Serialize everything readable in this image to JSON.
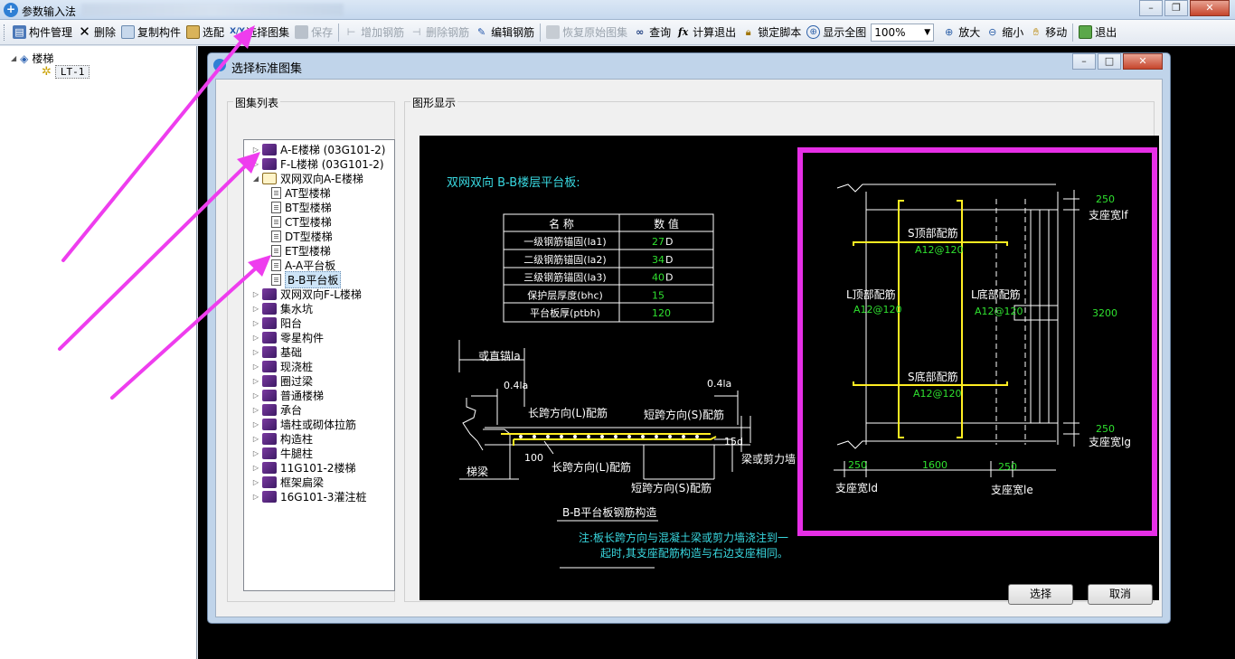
{
  "app": {
    "title": "参数输入法"
  },
  "toolbar": {
    "items": [
      {
        "label": "构件管理",
        "disabled": false
      },
      {
        "label": "删除",
        "disabled": false
      },
      {
        "label": "复制构件",
        "disabled": false
      },
      {
        "label": "选配",
        "disabled": false
      },
      {
        "label": "选择图集",
        "disabled": false
      },
      {
        "label": "保存",
        "disabled": true
      },
      {
        "label": "增加钢筋",
        "disabled": true
      },
      {
        "label": "删除钢筋",
        "disabled": true
      },
      {
        "label": "编辑钢筋",
        "disabled": false
      },
      {
        "label": "恢复原始图集",
        "disabled": true
      },
      {
        "label": "查询",
        "disabled": false
      },
      {
        "label": "计算退出",
        "disabled": false
      },
      {
        "label": "锁定脚本",
        "disabled": false
      },
      {
        "label": "显示全图",
        "disabled": false
      },
      {
        "label": "放大",
        "disabled": false
      },
      {
        "label": "缩小",
        "disabled": false
      },
      {
        "label": "移动",
        "disabled": false
      },
      {
        "label": "退出",
        "disabled": false
      }
    ],
    "zoom": "100%"
  },
  "tree": {
    "root": "楼梯",
    "child": "LT-1"
  },
  "dialog": {
    "title": "选择标准图集",
    "list_group_label": "图集列表",
    "display_group_label": "图形显示",
    "items": [
      {
        "label": "A-E楼梯 (03G101-2)",
        "level": 0,
        "icon": "book",
        "toggle": "▷"
      },
      {
        "label": "F-L楼梯 (03G101-2)",
        "level": 0,
        "icon": "book",
        "toggle": "▷"
      },
      {
        "label": "双网双向A-E楼梯",
        "level": 0,
        "icon": "book-open",
        "toggle": "◢"
      },
      {
        "label": "AT型楼梯",
        "level": 1,
        "icon": "doc",
        "toggle": ""
      },
      {
        "label": "BT型楼梯",
        "level": 1,
        "icon": "doc",
        "toggle": ""
      },
      {
        "label": "CT型楼梯",
        "level": 1,
        "icon": "doc",
        "toggle": ""
      },
      {
        "label": "DT型楼梯",
        "level": 1,
        "icon": "doc",
        "toggle": ""
      },
      {
        "label": "ET型楼梯",
        "level": 1,
        "icon": "doc",
        "toggle": ""
      },
      {
        "label": "A-A平台板",
        "level": 1,
        "icon": "doc",
        "toggle": ""
      },
      {
        "label": "B-B平台板",
        "level": 1,
        "icon": "doc",
        "toggle": "",
        "selected": true
      },
      {
        "label": "双网双向F-L楼梯",
        "level": 0,
        "icon": "book",
        "toggle": "▷"
      },
      {
        "label": "集水坑",
        "level": 0,
        "icon": "book",
        "toggle": "▷"
      },
      {
        "label": "阳台",
        "level": 0,
        "icon": "book",
        "toggle": "▷"
      },
      {
        "label": "零星构件",
        "level": 0,
        "icon": "book",
        "toggle": "▷"
      },
      {
        "label": "基础",
        "level": 0,
        "icon": "book",
        "toggle": "▷"
      },
      {
        "label": "现浇桩",
        "level": 0,
        "icon": "book",
        "toggle": "▷"
      },
      {
        "label": "圈过梁",
        "level": 0,
        "icon": "book",
        "toggle": "▷"
      },
      {
        "label": "普通楼梯",
        "level": 0,
        "icon": "book",
        "toggle": "▷"
      },
      {
        "label": "承台",
        "level": 0,
        "icon": "book",
        "toggle": "▷"
      },
      {
        "label": "墙柱或砌体拉筋",
        "level": 0,
        "icon": "book",
        "toggle": "▷"
      },
      {
        "label": "构造柱",
        "level": 0,
        "icon": "book",
        "toggle": "▷"
      },
      {
        "label": "牛腿柱",
        "level": 0,
        "icon": "book",
        "toggle": "▷"
      },
      {
        "label": "11G101-2楼梯",
        "level": 0,
        "icon": "book",
        "toggle": "▷"
      },
      {
        "label": "框架扁梁",
        "level": 0,
        "icon": "book",
        "toggle": "▷"
      },
      {
        "label": "16G101-3灌注桩",
        "level": 0,
        "icon": "book",
        "toggle": "▷"
      }
    ],
    "select_label": "选择",
    "cancel_label": "取消"
  },
  "drawing": {
    "heading": "双网双向 B-B楼层平台板:",
    "table_headers": [
      "名 称",
      "数 值"
    ],
    "table_rows": [
      {
        "name": "一级钢筋锚固(la1)",
        "value": "27",
        "unit": "D"
      },
      {
        "name": "二级钢筋锚固(la2)",
        "value": "34",
        "unit": "D"
      },
      {
        "name": "三级钢筋锚固(la3)",
        "value": "40",
        "unit": "D"
      },
      {
        "name": "保护层厚度(bhc)",
        "value": "15",
        "unit": ""
      },
      {
        "name": "平台板厚(ptbh)",
        "value": "120",
        "unit": ""
      }
    ],
    "section": {
      "straight_anchor": "或直锚la",
      "left_04la": "0.4la",
      "right_04la": "0.4la",
      "long_top": "长跨方向(L)配筋",
      "short_top": "短跨方向(S)配筋",
      "long_bottom": "长跨方向(L)配筋",
      "short_bottom": "短跨方向(S)配筋",
      "dim_100": "100",
      "dim_15d": "15d",
      "stair_beam": "梯梁",
      "beam_or_wall": "梁或剪力墙",
      "caption": "B-B平台板钢筋构造",
      "note_line1": "注:板长跨方向与混凝土梁或剪力墙浇注到一",
      "note_line2": "起时,其支座配筋构造与右边支座相同。"
    },
    "plan": {
      "s_top": "S顶部配筋",
      "s_top_val": "A12@120",
      "l_top": "L顶部配筋",
      "l_top_val": "A12@120",
      "l_bottom": "L底部配筋",
      "l_bottom_val": "A12@120",
      "s_bottom": "S底部配筋",
      "s_bottom_val": "A12@120",
      "dim_top": "250",
      "support_lf": "支座宽lf",
      "dim_height": "3200",
      "dim_bottom": "250",
      "support_lg": "支座宽lg",
      "dim_left": "250",
      "dim_width": "1600",
      "dim_right": "250",
      "support_ld": "支座宽ld",
      "support_le": "支座宽le"
    }
  },
  "colors": {
    "cyan": "#39d8e0",
    "green": "#2fe02f",
    "yellow": "#ffee22",
    "highlight": "#e62fe6",
    "arrow": "#ee3dee"
  }
}
